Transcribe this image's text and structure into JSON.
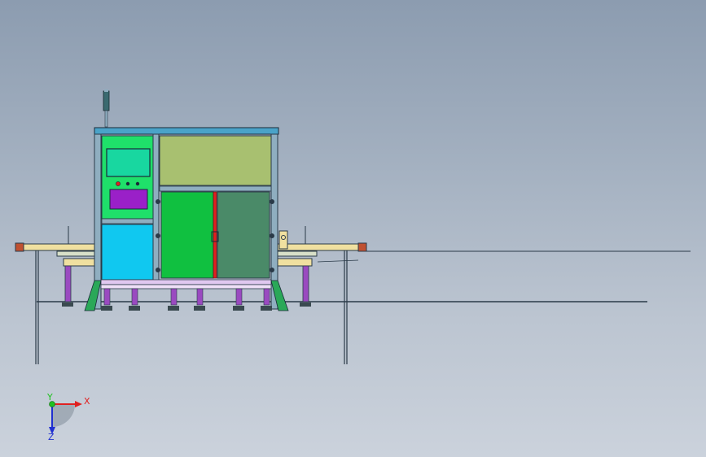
{
  "triad": {
    "x_label": "X",
    "y_label": "Y",
    "z_label": "Z",
    "x_color": "#e02020",
    "y_color": "#20c020",
    "z_color": "#2030d0"
  },
  "colors": {
    "frame": "#8faec0",
    "frame_dark": "#2a3a48",
    "top_beam": "#4aa3c8",
    "hmi_panel": "#1fe06a",
    "hmi_screen": "#18d7a0",
    "button_box": "#9a20c8",
    "cyan_panel": "#10c8f0",
    "upper_panel": "#a8c070",
    "door_left": "#10c040",
    "door_right": "#4a8a68",
    "door_handle": "#e02020",
    "legs": "#9a4ac0",
    "conveyor_rail": "#f0e0a0",
    "base_beam": "#e0c8f0",
    "feet": "#3a4a50",
    "side_brace": "#2aa858",
    "signal_tower": "#3a6a70"
  },
  "icons": {
    "triad": "coordinate-axes-icon",
    "emergency_stop": "emergency-stop-icon"
  }
}
